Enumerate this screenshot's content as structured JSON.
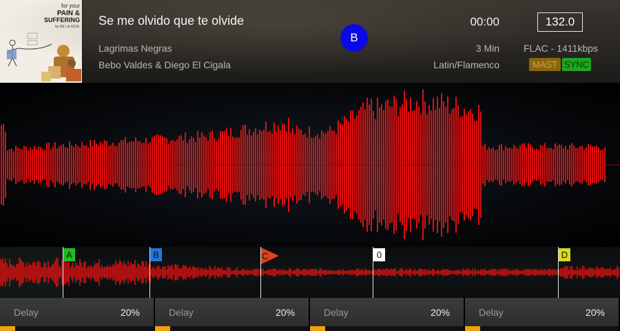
{
  "track": {
    "title": "Se me olvido que te olvide",
    "album": "Lagrimas Negras",
    "artist": "Bebo Valdes & Diego El Cigala",
    "elapsed": "00:00",
    "duration": "3 Min",
    "genre": "Latin/Flamenco",
    "bpm": "132.0",
    "format": "FLAC - 1411kbps"
  },
  "deck": {
    "label": "B",
    "badge_color": "#0a0ae6",
    "master_label": "MAST",
    "sync_label": "SYNC"
  },
  "album_art": {
    "line1": "for your",
    "line2": "PAIN &",
    "line3": "SUFFERING",
    "line4": "by DE LA SOUL"
  },
  "cue_points": [
    {
      "label": "A",
      "color": "#22bb22",
      "text_color": "#111",
      "position": 0.101
    },
    {
      "label": "B",
      "color": "#1f78e0",
      "text_color": "#111",
      "position": 0.241
    },
    {
      "label": "C",
      "color": "#e0401a",
      "text_color": "#111",
      "position": 0.42,
      "style": "flag"
    },
    {
      "label": "0",
      "color": "#ffffff",
      "text_color": "#111",
      "position": 0.601
    },
    {
      "label": "D",
      "color": "#d8d820",
      "text_color": "#111",
      "position": 0.9
    }
  ],
  "waveform_color": "#e01010",
  "fx_units": [
    {
      "name": "Delay",
      "value": "20%",
      "level": 0.1
    },
    {
      "name": "Delay",
      "value": "20%",
      "level": 0.1
    },
    {
      "name": "Delay",
      "value": "20%",
      "level": 0.1
    },
    {
      "name": "Delay",
      "value": "20%",
      "level": 0.1
    }
  ],
  "colors": {
    "master": "#8a6610",
    "sync": "#1fa51f",
    "fx_level": "#f0a010"
  }
}
